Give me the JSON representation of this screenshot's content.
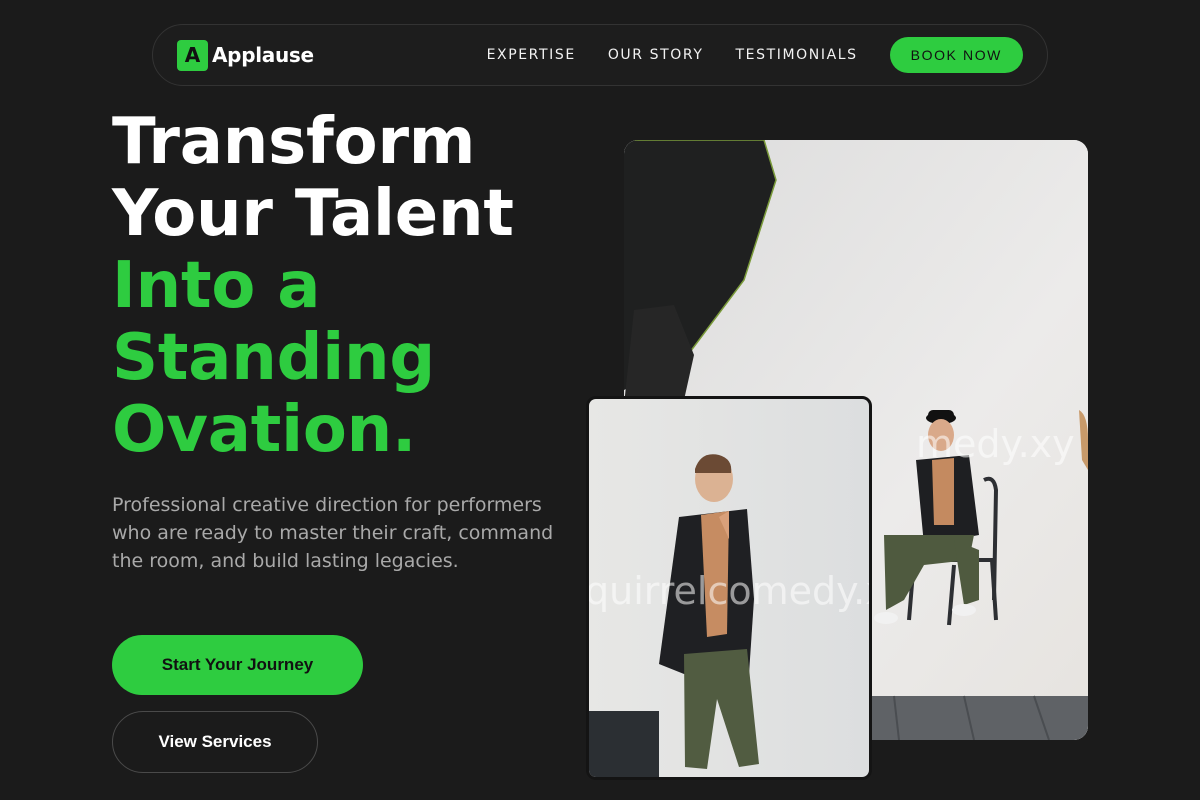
{
  "brand": {
    "logo_letter": "A",
    "name": "Applause",
    "accent": "#2ecc40"
  },
  "nav": {
    "links": [
      "EXPERTISE",
      "OUR STORY",
      "TESTIMONIALS"
    ],
    "cta": "BOOK NOW"
  },
  "hero": {
    "headline_white": [
      "Transform",
      "Your Talent"
    ],
    "headline_green": [
      "Into a",
      "Standing",
      "Ovation."
    ],
    "subtext": "Professional creative direction for performers who are ready to master their craft, command the room, and build lasting legacies.",
    "primary_button": "Start Your Journey",
    "secondary_button": "View Services"
  },
  "images": {
    "large_watermark": "medy.xy",
    "small_watermark": "quirrelcomedy.xy"
  }
}
